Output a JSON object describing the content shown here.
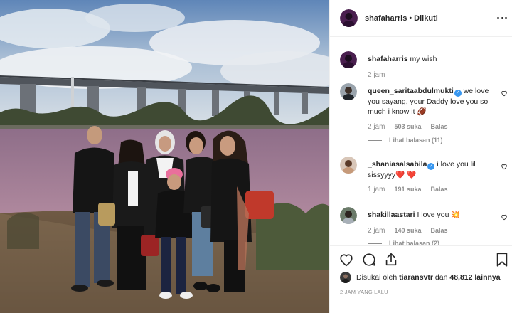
{
  "post": {
    "username": "shafaharris",
    "separator": "•",
    "follow_status": "Diikuti"
  },
  "caption": {
    "username": "shafaharris",
    "text": "my wish",
    "time": "2 jam"
  },
  "comments": [
    {
      "username": "queen_saritaabdulmukti",
      "verified": true,
      "text": "we love you sayang, your Daddy love you so much i know it 🏈",
      "time": "2 jam",
      "likes": "503 suka",
      "reply_label": "Balas",
      "view_replies": "Lihat balasan (11)"
    },
    {
      "username": "_shaniasalsabila",
      "verified": true,
      "text": "i love you lil sissyyyy❤️ ❤️",
      "time": "1 jam",
      "likes": "191 suka",
      "reply_label": "Balas"
    },
    {
      "username": "shakillaastari",
      "verified": false,
      "text": "I love you 💥",
      "time": "2 jam",
      "likes": "140 suka",
      "reply_label": "Balas",
      "view_replies": "Lihat balasan (2)"
    }
  ],
  "likes": {
    "prefix": "Disukai oleh",
    "user": "tiaransvtr",
    "connector": "dan",
    "others": "48,812 lainnya"
  },
  "timestamp": "2 JAM YANG LALU",
  "icons": {
    "more": "more-options-icon",
    "like": "heart-icon",
    "comment": "comment-icon",
    "share": "share-icon",
    "save": "bookmark-icon",
    "verified": "verified-badge-icon"
  },
  "colors": {
    "verified": "#3897f0",
    "meta_text": "#8e8e8e",
    "text": "#262626",
    "border": "#efefef"
  }
}
